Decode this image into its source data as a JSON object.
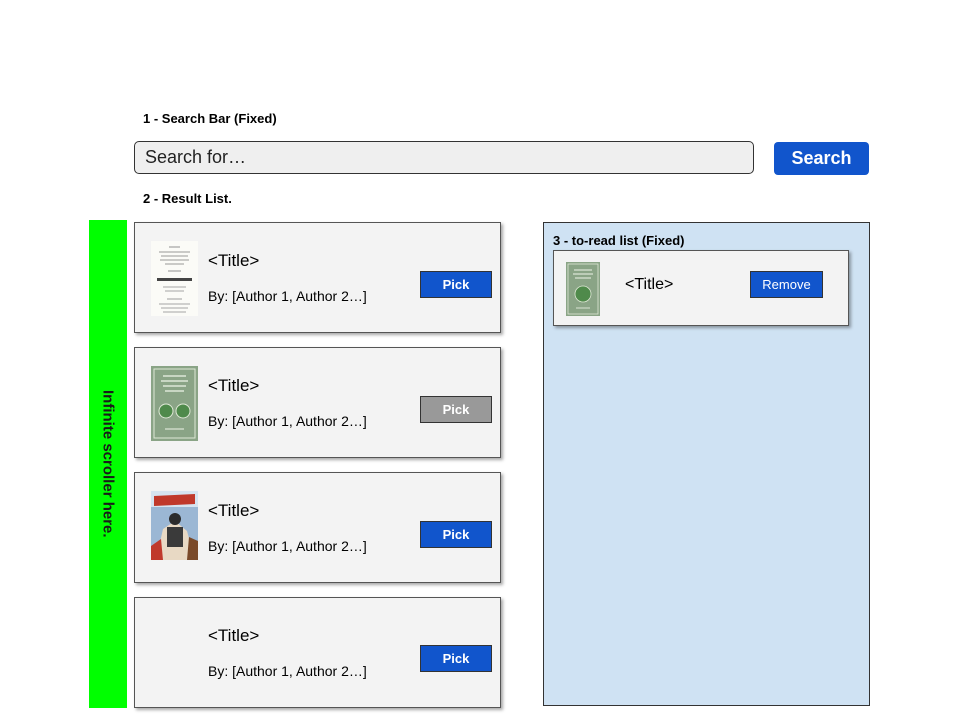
{
  "search_section": {
    "label": "1 - Search Bar (Fixed)",
    "input_placeholder": "Search for…",
    "button_label": "Search"
  },
  "results_section": {
    "label": "2 - Result List.",
    "scroller_label": "Infinite scroller here.",
    "items": [
      {
        "title": "<Title>",
        "authors": "By: [Author 1, Author 2…]",
        "pick_label": "Pick",
        "pick_enabled": true,
        "cover_icon": "old-printed-book-cover"
      },
      {
        "title": "<Title>",
        "authors": "By: [Author 1, Author 2…]",
        "pick_label": "Pick",
        "pick_enabled": false,
        "cover_icon": "green-book-cover"
      },
      {
        "title": "<Title>",
        "authors": "By: [Author 1, Author 2…]",
        "pick_label": "Pick",
        "pick_enabled": true,
        "cover_icon": "scifi-magazine-cover"
      },
      {
        "title": "<Title>",
        "authors": "By: [Author 1, Author 2…]",
        "pick_label": "Pick",
        "pick_enabled": true,
        "cover_icon": "none"
      }
    ]
  },
  "to_read_section": {
    "label": "3 - to-read list (Fixed)",
    "items": [
      {
        "title": "<Title>",
        "remove_label": "Remove",
        "cover_icon": "green-book-cover"
      }
    ]
  },
  "colors": {
    "accent": "#1155cc",
    "disabled": "#999999",
    "scroller": "#00ff00",
    "panel": "#cfe2f3",
    "card": "#f3f3f3"
  }
}
